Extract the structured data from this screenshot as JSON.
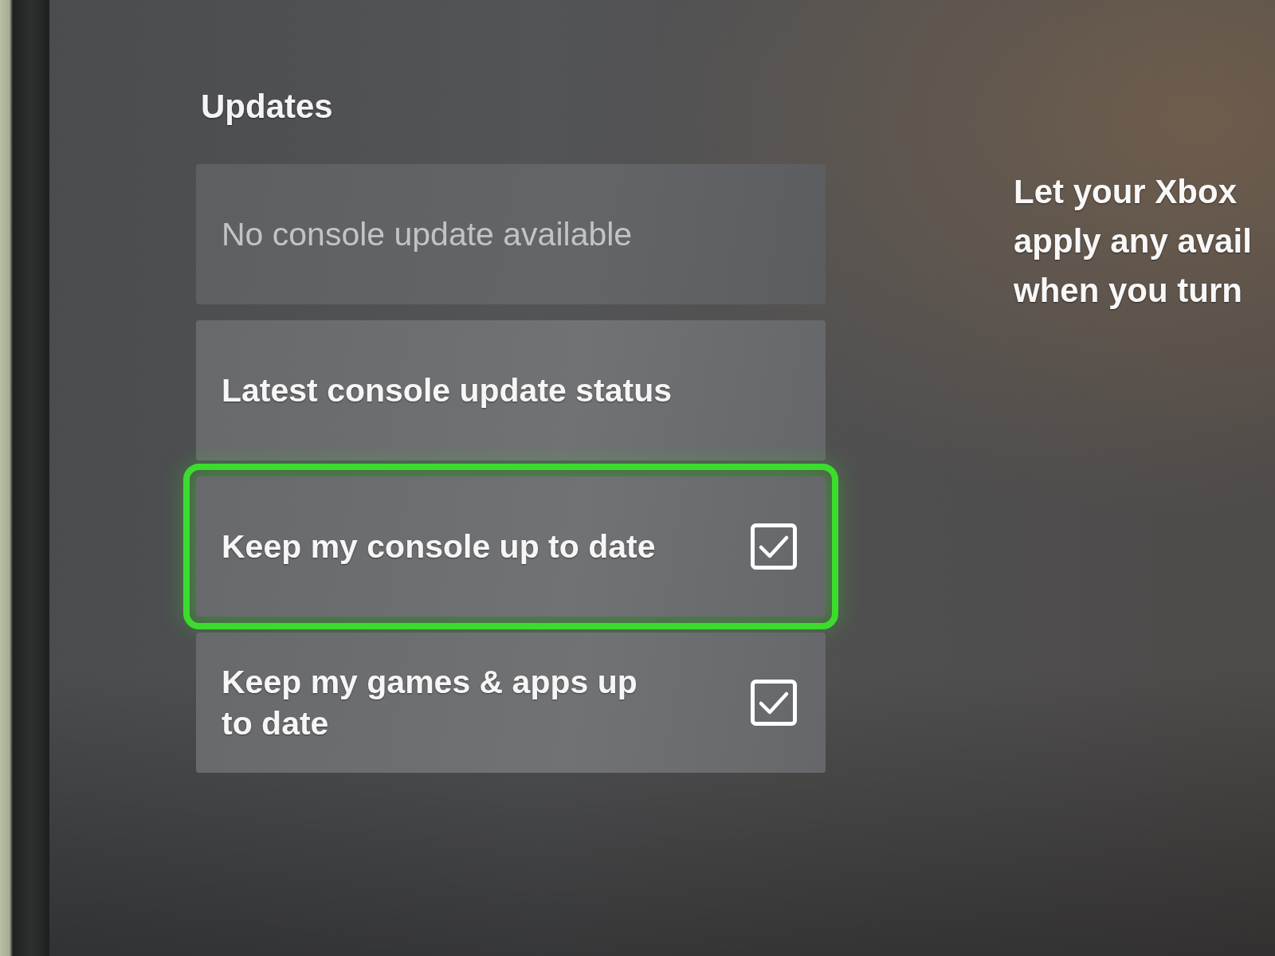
{
  "section_title": "Updates",
  "items": [
    {
      "kind": "status",
      "label": "No console update available",
      "disabled": true,
      "selected": false
    },
    {
      "kind": "link",
      "label": "Latest console update status",
      "disabled": false,
      "selected": false
    },
    {
      "kind": "checkbox",
      "label": "Keep my console up to date",
      "checked": true,
      "disabled": false,
      "selected": true
    },
    {
      "kind": "checkbox",
      "label": "Keep my games & apps up to date",
      "checked": true,
      "disabled": false,
      "selected": false
    }
  ],
  "description_lines": [
    "Let your Xbox",
    "apply any avail",
    "when you turn"
  ]
}
